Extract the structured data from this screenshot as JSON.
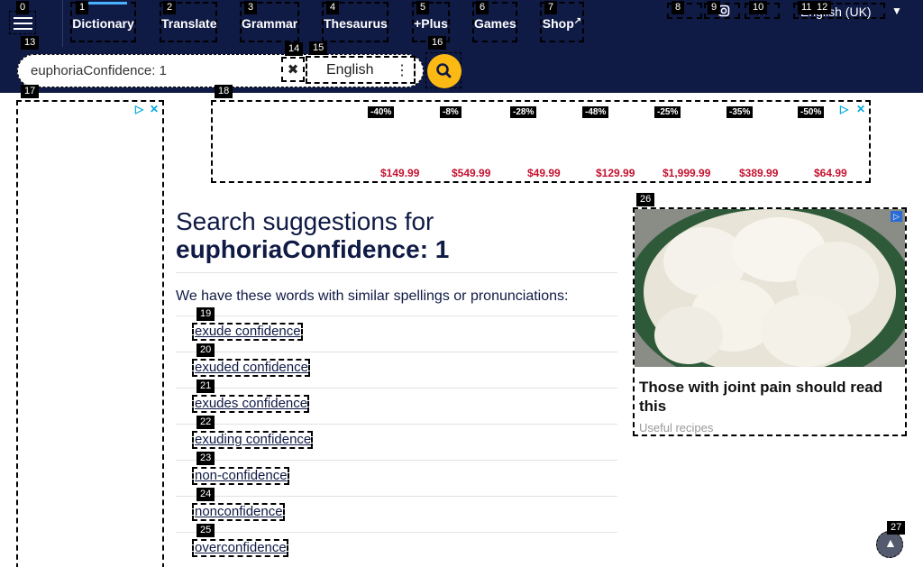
{
  "nav": {
    "items": [
      {
        "label": "Dictionary"
      },
      {
        "label": "Translate"
      },
      {
        "label": "Grammar"
      },
      {
        "label": "Thesaurus"
      },
      {
        "label": "+Plus"
      },
      {
        "label": "Games"
      },
      {
        "label": "Shop"
      }
    ],
    "language": "English (UK)"
  },
  "search": {
    "value": "euphoriaConfidence: 1",
    "dictionary": "English"
  },
  "ads": {
    "top": {
      "discounts": [
        "-40%",
        "-8%",
        "-28%",
        "-48%",
        "-25%",
        "-35%",
        "-50%"
      ],
      "prices": [
        "$149.99",
        "$549.99",
        "$49.99",
        "$129.99",
        "$1,999.99",
        "$389.99",
        "$64.99"
      ]
    },
    "right": {
      "title": "Those with joint pain should read this",
      "source": "Useful recipes"
    }
  },
  "suggestions": {
    "heading": "Search suggestions for",
    "query": "euphoriaConfidence: 1",
    "intro": "We have these words with similar spellings or pronunciations:",
    "items": [
      "exude confidence",
      "exuded confidence",
      "exudes confidence",
      "exuding confidence",
      "non-confidence",
      "nonconfidence",
      "overconfidence"
    ]
  },
  "badges": [
    "0",
    "1",
    "2",
    "3",
    "4",
    "5",
    "6",
    "7",
    "8",
    "9",
    "10",
    "11",
    "12",
    "13",
    "14",
    "15",
    "16",
    "17",
    "18",
    "19",
    "20",
    "21",
    "22",
    "23",
    "24",
    "25",
    "26",
    "27"
  ],
  "colors": {
    "nav": "#0f1a45",
    "accent": "#fdb913",
    "price": "#c41230",
    "link": "#0f1a45"
  }
}
